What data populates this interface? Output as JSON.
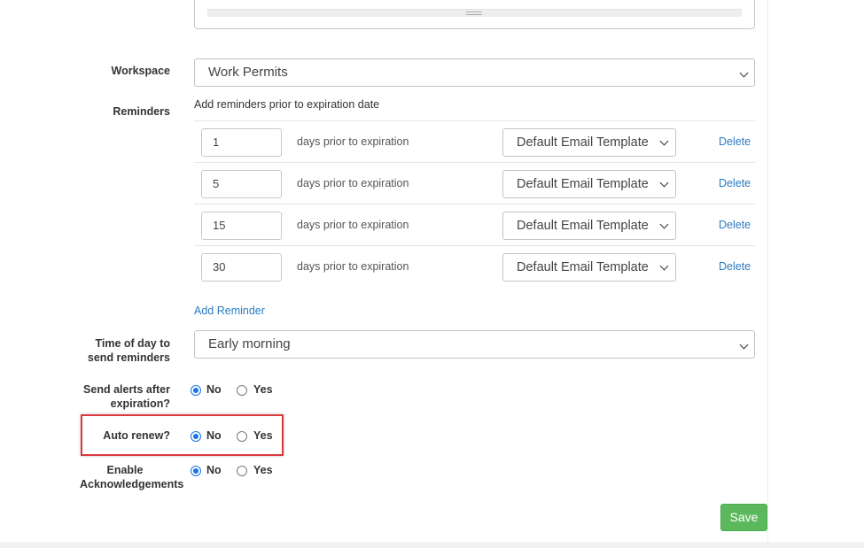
{
  "workspace": {
    "label": "Workspace",
    "value": "Work Permits"
  },
  "reminders": {
    "label": "Reminders",
    "hint": "Add reminders prior to expiration date",
    "rows": [
      {
        "days": "1",
        "text": "days prior to expiration",
        "template": "Default Email Template",
        "delete_label": "Delete"
      },
      {
        "days": "5",
        "text": "days prior to expiration",
        "template": "Default Email Template",
        "delete_label": "Delete"
      },
      {
        "days": "15",
        "text": "days prior to expiration",
        "template": "Default Email Template",
        "delete_label": "Delete"
      },
      {
        "days": "30",
        "text": "days prior to expiration",
        "template": "Default Email Template",
        "delete_label": "Delete"
      }
    ],
    "add_label": "Add Reminder"
  },
  "time_of_day": {
    "label_line1": "Time of day to",
    "label_line2": "send reminders",
    "value": "Early morning"
  },
  "send_alerts": {
    "label_line1": "Send alerts after",
    "label_line2": "expiration?",
    "options": [
      "No",
      "Yes"
    ],
    "selected": "No"
  },
  "auto_renew": {
    "label": "Auto renew?",
    "options": [
      "No",
      "Yes"
    ],
    "selected": "No"
  },
  "acknowledgements": {
    "label_line1": "Enable",
    "label_line2": "Acknowledgements",
    "options": [
      "No",
      "Yes"
    ],
    "selected": "No"
  },
  "save_label": "Save",
  "colors": {
    "link": "#2a7bbf",
    "save_button": "#5cb85c",
    "highlight": "#d9393f",
    "radio_checked": "#1a73e8"
  }
}
